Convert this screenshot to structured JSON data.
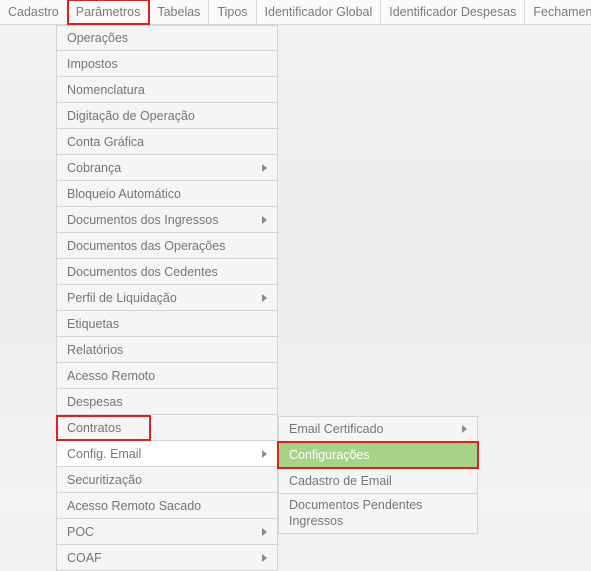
{
  "menubar": {
    "items": [
      {
        "label": "Cadastro"
      },
      {
        "label": "Parâmetros"
      },
      {
        "label": "Tabelas"
      },
      {
        "label": "Tipos"
      },
      {
        "label": "Identificador Global"
      },
      {
        "label": "Identificador Despesas"
      },
      {
        "label": "Fechamento"
      }
    ]
  },
  "dropdown": {
    "items": [
      {
        "label": "Operações",
        "has_sub": false
      },
      {
        "label": "Impostos",
        "has_sub": false
      },
      {
        "label": "Nomenclatura",
        "has_sub": false
      },
      {
        "label": "Digitação de Operação",
        "has_sub": false
      },
      {
        "label": "Conta Gráfica",
        "has_sub": false
      },
      {
        "label": "Cobrança",
        "has_sub": true
      },
      {
        "label": "Bloqueio Automático",
        "has_sub": false
      },
      {
        "label": "Documentos dos Ingressos",
        "has_sub": true
      },
      {
        "label": "Documentos das Operações",
        "has_sub": false
      },
      {
        "label": "Documentos dos Cedentes",
        "has_sub": false
      },
      {
        "label": "Perfil de Liquidação",
        "has_sub": true
      },
      {
        "label": "Etiquetas",
        "has_sub": false
      },
      {
        "label": "Relatórios",
        "has_sub": false
      },
      {
        "label": "Acesso Remoto",
        "has_sub": false
      },
      {
        "label": "Despesas",
        "has_sub": false
      },
      {
        "label": "Contratos",
        "has_sub": false
      },
      {
        "label": "Config. Email",
        "has_sub": true
      },
      {
        "label": "Securitização",
        "has_sub": false
      },
      {
        "label": "Acesso Remoto Sacado",
        "has_sub": false
      },
      {
        "label": "POC",
        "has_sub": true
      },
      {
        "label": "COAF",
        "has_sub": true
      }
    ]
  },
  "submenu": {
    "items": [
      {
        "label": "Email Certificado",
        "has_sub": true
      },
      {
        "label": "Configurações",
        "has_sub": false
      },
      {
        "label": "Cadastro de Email",
        "has_sub": false
      },
      {
        "label": "Documentos Pendentes Ingressos",
        "has_sub": false
      }
    ]
  }
}
